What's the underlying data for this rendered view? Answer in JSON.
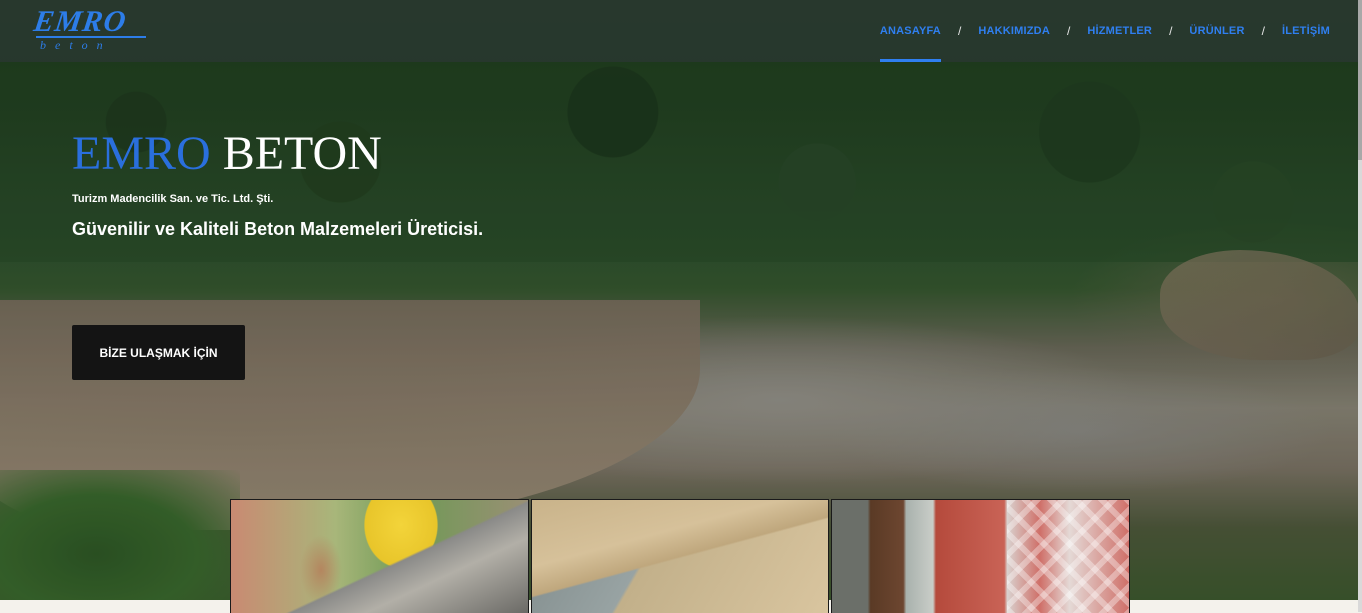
{
  "header": {
    "logo": {
      "main": "EMRO",
      "sub": "beton"
    },
    "nav": [
      {
        "label": "ANASAYFA",
        "active": true
      },
      {
        "label": "HAKKIMIZDA",
        "active": false
      },
      {
        "label": "HİZMETLER",
        "active": false
      },
      {
        "label": "ÜRÜNLER",
        "active": false
      },
      {
        "label": "İLETİŞİM",
        "active": false
      }
    ],
    "separator": "/"
  },
  "hero": {
    "brand_part1": "EMRO",
    "brand_part2": "BETON",
    "company": "Turizm Madencilik San. ve Tic. Ltd. Şti.",
    "tagline": "Güvenilir ve Kaliteli Beton Malzemeleri Üreticisi.",
    "cta_label": "BİZE ULAŞMAK İÇİN"
  },
  "colors": {
    "accent": "#2f7ff0",
    "brand_blue": "#2a6fdd",
    "cta_background": "#141414"
  },
  "products": [
    {
      "name": "concrete-pouring-image"
    },
    {
      "name": "aggregate-sand-image"
    },
    {
      "name": "paving-stone-image"
    }
  ]
}
